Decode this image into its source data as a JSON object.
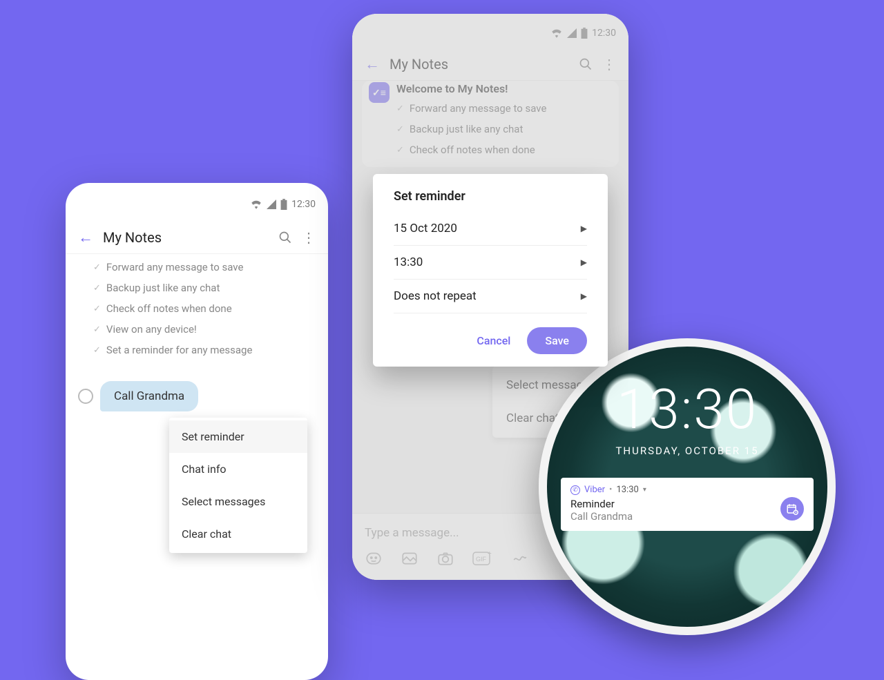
{
  "shared": {
    "status_time": "12:30",
    "header_title": "My Notes"
  },
  "phone1": {
    "checklist": [
      "Forward any message to save",
      "Backup just like any chat",
      "Check off notes when done",
      "View on any device!",
      "Set a reminder for any message"
    ],
    "bubble_text": "Call Grandma",
    "context_menu": [
      "Set reminder",
      "Chat info",
      "Select messages",
      "Clear chat"
    ]
  },
  "phone2": {
    "welcome_title": "Welcome to My Notes!",
    "welcome_list": [
      "Forward any message to save",
      "Backup just like any chat",
      "Check off notes when done"
    ],
    "visible_actions": [
      "Select messages",
      "Clear chat"
    ],
    "dialog": {
      "title": "Set reminder",
      "date": "15 Oct 2020",
      "time": "13:30",
      "repeat": "Does not repeat",
      "cancel_label": "Cancel",
      "save_label": "Save"
    },
    "input_placeholder": "Type a message..."
  },
  "lock": {
    "time": "13:30",
    "date": "THURSDAY, OCTOBER 15",
    "notif": {
      "app": "Viber",
      "time": "13:30",
      "title": "Reminder",
      "body": "Call Grandma"
    }
  }
}
